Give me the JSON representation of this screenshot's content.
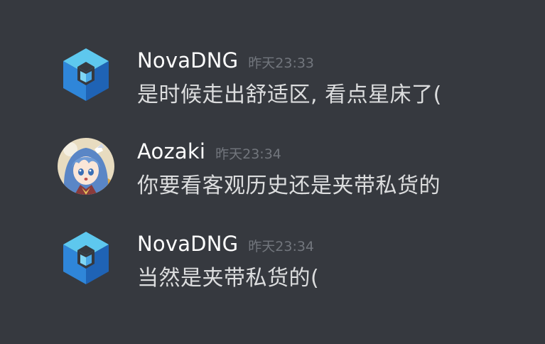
{
  "messages": [
    {
      "username": "NovaDNG",
      "timestamp": "昨天23:33",
      "content": "是时候走出舒适区, 看点星床了(",
      "avatar": "nova-logo-icon"
    },
    {
      "username": "Aozaki",
      "timestamp": "昨天23:34",
      "content": "你要看客观历史还是夹带私货的",
      "avatar": "anime-girl-avatar"
    },
    {
      "username": "NovaDNG",
      "timestamp": "昨天23:34",
      "content": "当然是夹带私货的(",
      "avatar": "nova-logo-icon"
    }
  ],
  "colors": {
    "background": "#36393f",
    "username": "#ffffff",
    "timestamp": "#72767d",
    "content": "#dcddde",
    "logo_light": "#5ec8ee",
    "logo_mid": "#2f86d9",
    "logo_dark": "#1f63b5"
  }
}
